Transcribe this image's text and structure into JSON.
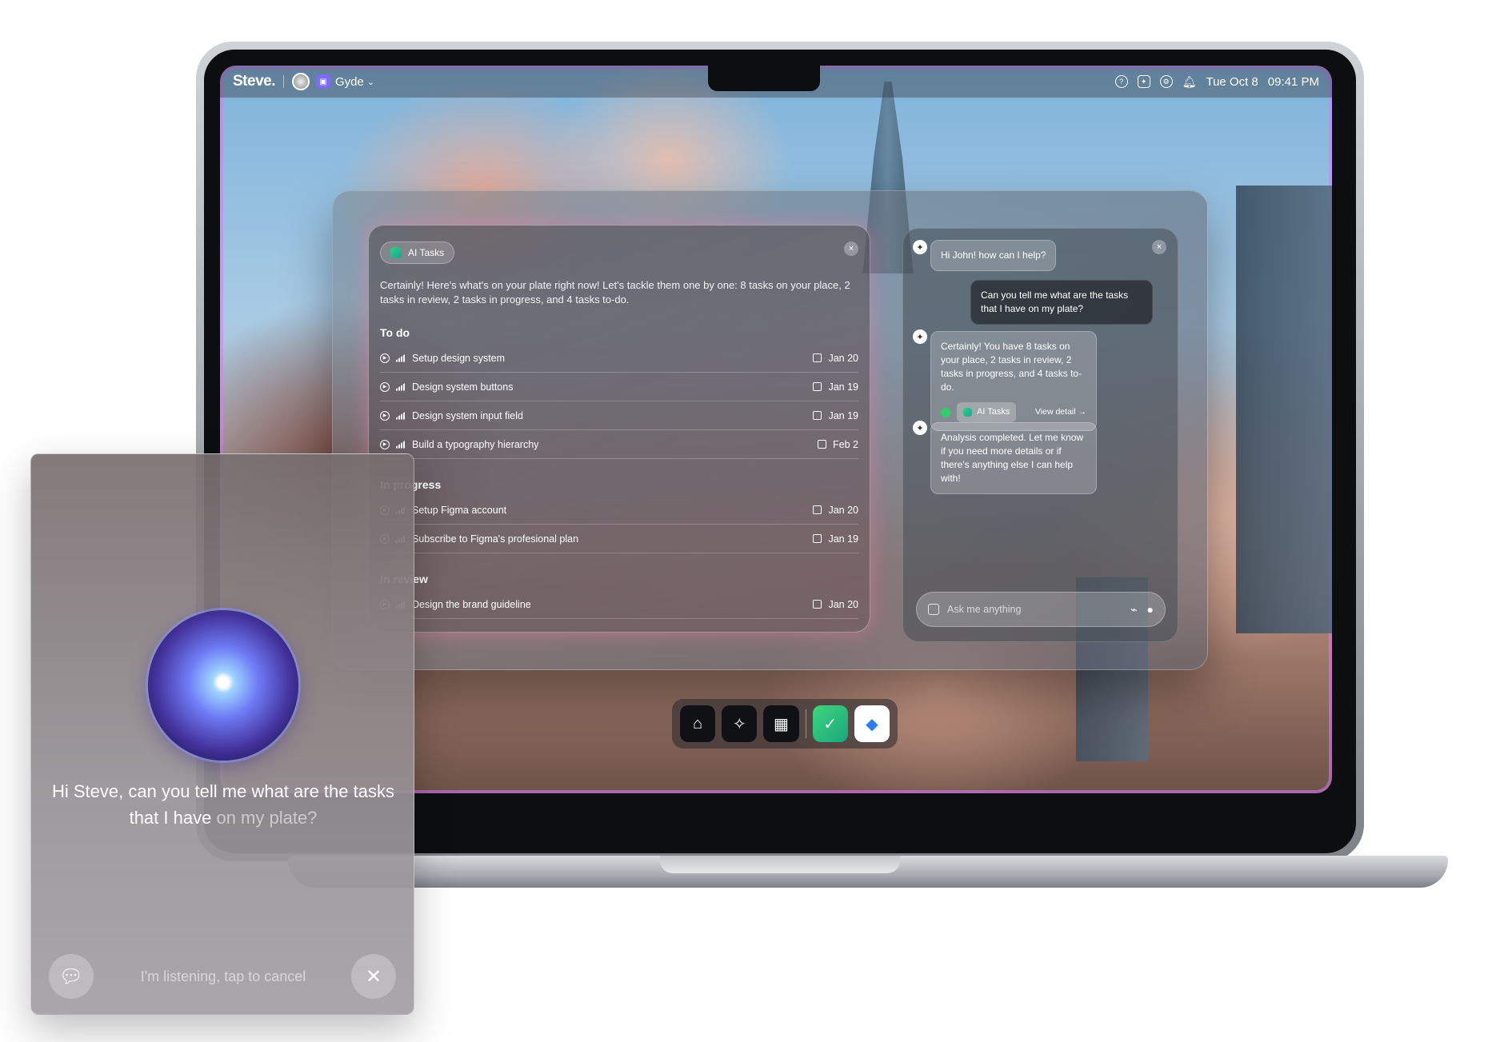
{
  "menubar": {
    "brand": "Steve.",
    "workspace": "Gyde",
    "workspace_caret": "⌄",
    "date": "Tue Oct 8",
    "time": "09:41 PM"
  },
  "tasks_panel": {
    "chip": "AI Tasks",
    "close": "×",
    "intro": "Certainly! Here's what's on your plate right now! Let's tackle them one by one: 8 tasks on your place, 2 tasks in review, 2 tasks in progress, and 4 tasks to-do.",
    "sections": [
      {
        "title": "To do",
        "items": [
          {
            "name": "Setup design system",
            "date": "Jan 20"
          },
          {
            "name": "Design system buttons",
            "date": "Jan 19"
          },
          {
            "name": "Design system input field",
            "date": "Jan 19"
          },
          {
            "name": "Build a typography hierarchy",
            "date": "Feb 2"
          }
        ]
      },
      {
        "title": "In progress",
        "items": [
          {
            "name": "Setup Figma account",
            "date": "Jan 20"
          },
          {
            "name": "Subscribe to Figma's profesional plan",
            "date": "Jan 19"
          }
        ]
      },
      {
        "title": "In review",
        "items": [
          {
            "name": "Design the brand guideline",
            "date": "Jan 20"
          }
        ]
      }
    ]
  },
  "chat": {
    "close": "×",
    "greeting": "Hi John! how can I help?",
    "user_message": "Can you tell me what are the tasks that I have on my plate?",
    "ai_reply": "Certainly! You have 8 tasks on your place, 2 tasks in review, 2 tasks in progress, and 4 tasks to-do.",
    "ai_chip": "AI Tasks",
    "view_detail": "View detail →",
    "ai_followup": "Analysis completed. Let me know if you need more details or if there's anything else I can help with!",
    "input_placeholder": "Ask me anything"
  },
  "dock": {
    "items": [
      "home-icon",
      "chat-spark-icon",
      "grid-icon",
      "ai-tasks-app",
      "gyde-app"
    ]
  },
  "phone": {
    "prompt_main": "Hi Steve, can you tell me what are the tasks that I have",
    "prompt_dim": "on my plate?",
    "status": "I'm listening, tap to cancel"
  },
  "colors": {
    "accent_pink": "#ff78aa",
    "success_green": "#2fce6b"
  }
}
